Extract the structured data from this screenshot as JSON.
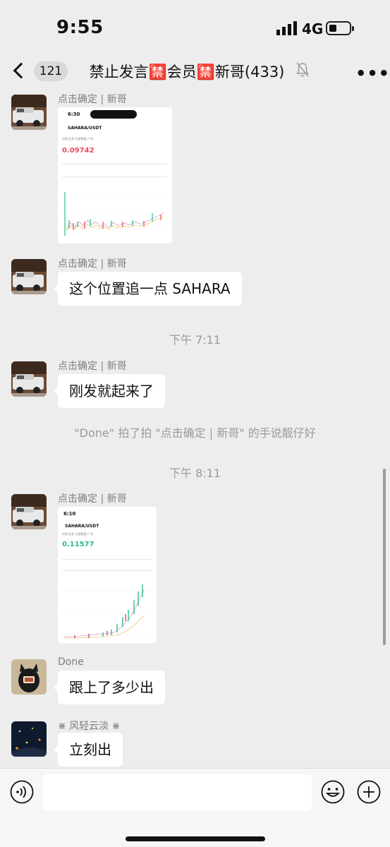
{
  "status_bar": {
    "time": "9:55",
    "network": "4G"
  },
  "nav": {
    "unread_count": "121",
    "title": "禁止发言🈲会员🈲新哥(433)"
  },
  "messages": {
    "m1": {
      "sender": "点击确定 | 新哥",
      "image": {
        "time": "6:30",
        "pair": "SAHARA/USDT",
        "price": "0.09742",
        "tabs": "价格  信息  交易数据  广场"
      }
    },
    "m2": {
      "sender": "点击确定 | 新哥",
      "text": "这个位置追一点 SAHARA"
    },
    "t1": "下午 7:11",
    "m3": {
      "sender": "点击确定 | 新哥",
      "text": "刚发就起来了"
    },
    "sys": "\"Done\" 拍了拍 \"点击确定 | 新哥\" 的手说靓仔好",
    "t2": "下午 8:11",
    "m4": {
      "sender": "点击确定 | 新哥",
      "image": {
        "time": "6:10",
        "pair": "SAHARA/USDT",
        "price": "0.11577",
        "tabs": "价格  信息  交易数据  广场"
      }
    },
    "m5": {
      "sender": "Done",
      "text": "跟上了多少出"
    },
    "m6": {
      "sender": "⋇ 风轻云淡 ⋇",
      "text": "立刻出"
    }
  },
  "colors": {
    "price_down": "#e84a5f",
    "price_up": "#2ebd85",
    "chat_bg": "#ededed"
  },
  "icons": [
    "chevron-left-icon",
    "mute-bell-icon",
    "more-icon",
    "voice-icon",
    "emoji-icon",
    "plus-icon"
  ]
}
